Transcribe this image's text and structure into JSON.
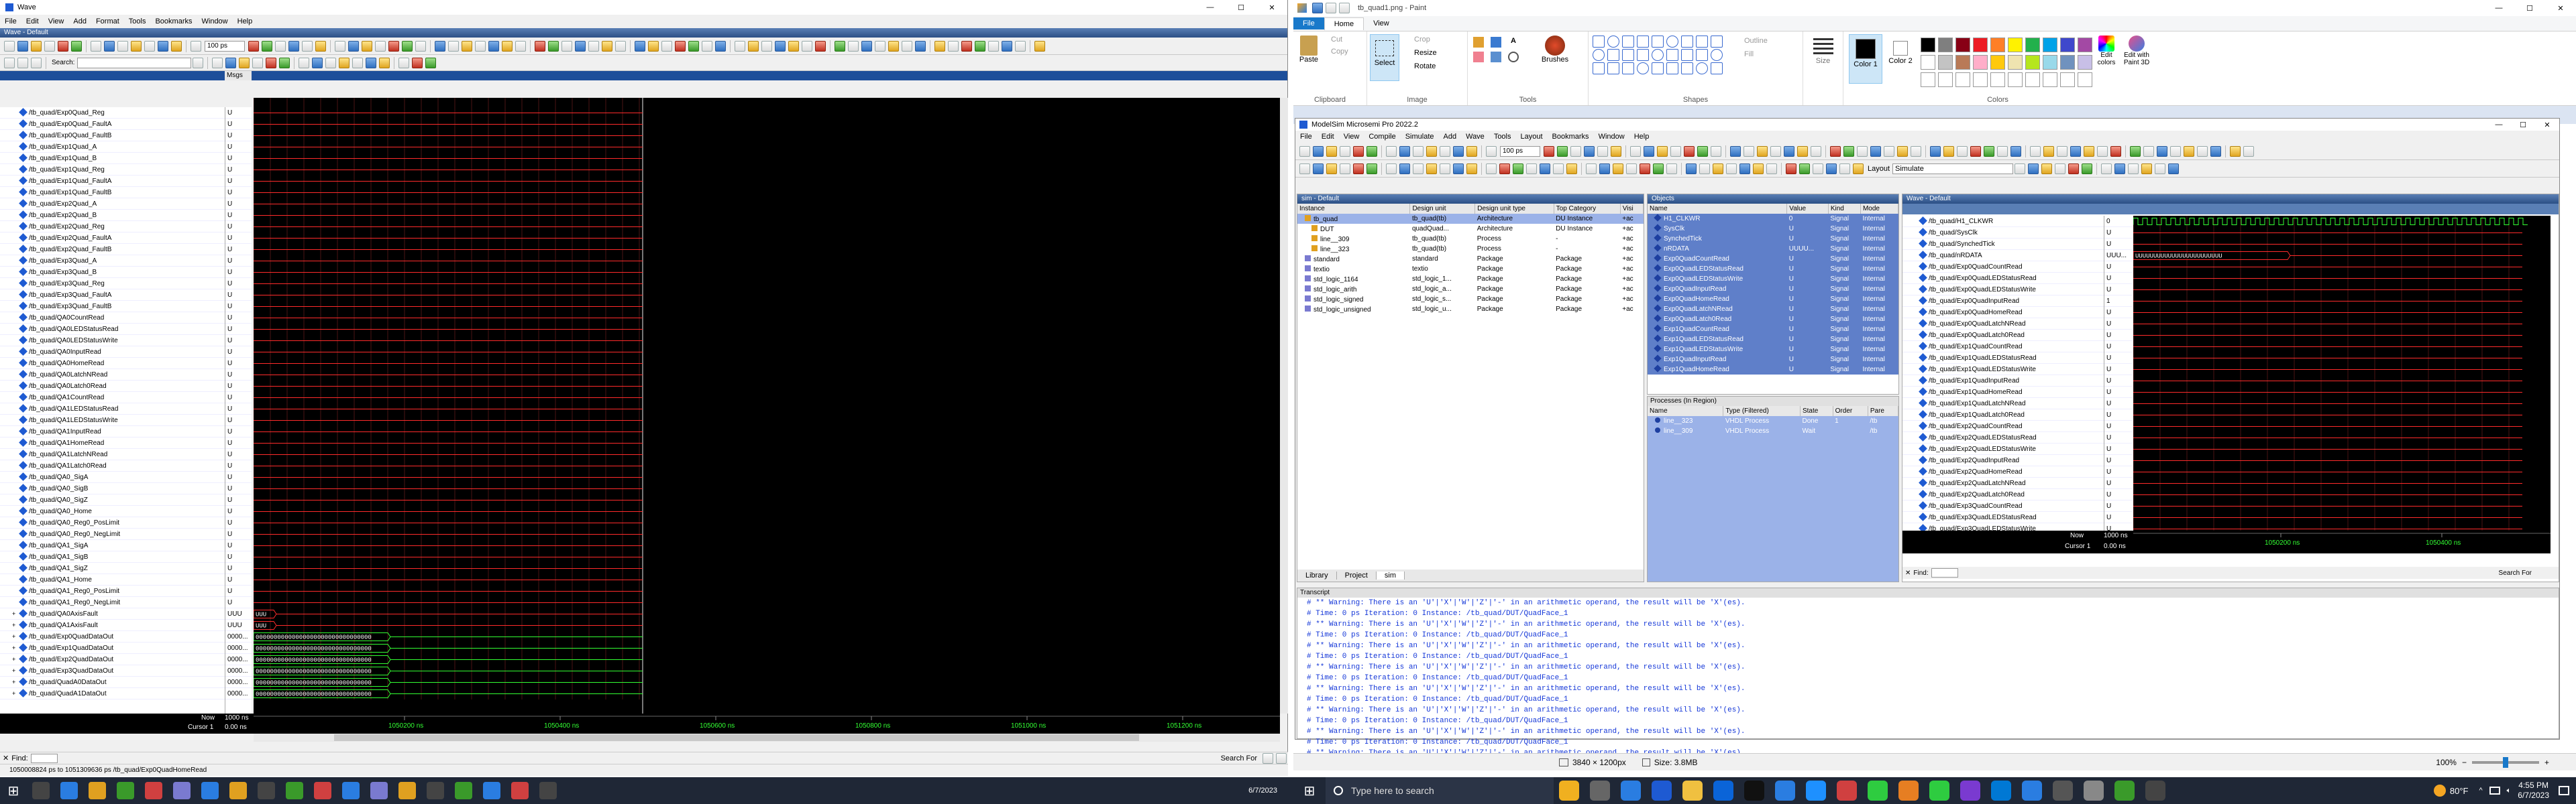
{
  "left_window": {
    "title": "Wave",
    "menu": [
      "File",
      "Edit",
      "View",
      "Add",
      "Format",
      "Tools",
      "Bookmarks",
      "Window",
      "Help"
    ],
    "pane_title": "Wave - Default",
    "time_step": "100 ps",
    "search_placeholder": "Search:",
    "msgs_header": "Msgs",
    "signals": [
      "/tb_quad/Exp0Quad_Reg",
      "/tb_quad/Exp0Quad_FaultA",
      "/tb_quad/Exp0Quad_FaultB",
      "/tb_quad/Exp1Quad_A",
      "/tb_quad/Exp1Quad_B",
      "/tb_quad/Exp1Quad_Reg",
      "/tb_quad/Exp1Quad_FaultA",
      "/tb_quad/Exp1Quad_FaultB",
      "/tb_quad/Exp2Quad_A",
      "/tb_quad/Exp2Quad_B",
      "/tb_quad/Exp2Quad_Reg",
      "/tb_quad/Exp2Quad_FaultA",
      "/tb_quad/Exp2Quad_FaultB",
      "/tb_quad/Exp3Quad_A",
      "/tb_quad/Exp3Quad_B",
      "/tb_quad/Exp3Quad_Reg",
      "/tb_quad/Exp3Quad_FaultA",
      "/tb_quad/Exp3Quad_FaultB",
      "/tb_quad/QA0CountRead",
      "/tb_quad/QA0LEDStatusRead",
      "/tb_quad/QA0LEDStatusWrite",
      "/tb_quad/QA0InputRead",
      "/tb_quad/QA0HomeRead",
      "/tb_quad/QA0LatchNRead",
      "/tb_quad/QA0Latch0Read",
      "/tb_quad/QA1CountRead",
      "/tb_quad/QA1LEDStatusRead",
      "/tb_quad/QA1LEDStatusWrite",
      "/tb_quad/QA1InputRead",
      "/tb_quad/QA1HomeRead",
      "/tb_quad/QA1LatchNRead",
      "/tb_quad/QA1Latch0Read",
      "/tb_quad/QA0_SigA",
      "/tb_quad/QA0_SigB",
      "/tb_quad/QA0_SigZ",
      "/tb_quad/QA0_Home",
      "/tb_quad/QA0_Reg0_PosLimit",
      "/tb_quad/QA0_Reg0_NegLimit",
      "/tb_quad/QA1_SigA",
      "/tb_quad/QA1_SigB",
      "/tb_quad/QA1_SigZ",
      "/tb_quad/QA1_Home",
      "/tb_quad/QA1_Reg0_PosLimit",
      "/tb_quad/QA1_Reg0_NegLimit",
      "/tb_quad/QA0AxisFault",
      "/tb_quad/QA1AxisFault",
      "/tb_quad/Exp0QuadDataOut",
      "/tb_quad/Exp1QuadDataOut",
      "/tb_quad/Exp2QuadDataOut",
      "/tb_quad/Exp3QuadDataOut",
      "/tb_quad/QuadA0DataOut",
      "/tb_quad/QuadA1DataOut"
    ],
    "values": [
      "U",
      "U",
      "U",
      "U",
      "U",
      "U",
      "U",
      "U",
      "U",
      "U",
      "U",
      "U",
      "U",
      "U",
      "U",
      "U",
      "U",
      "U",
      "U",
      "U",
      "U",
      "U",
      "U",
      "U",
      "U",
      "U",
      "U",
      "U",
      "U",
      "U",
      "U",
      "U",
      "U",
      "U",
      "U",
      "U",
      "U",
      "U",
      "U",
      "U",
      "U",
      "U",
      "U",
      "U",
      "UUU",
      "UUU",
      "0000...",
      "0000...",
      "0000...",
      "0000...",
      "0000...",
      "0000..."
    ],
    "bus_text_small": "UUU",
    "bus_text_long": "00000000000000000000000000000000",
    "now_label": "Now",
    "now_value": "1000 ns",
    "cursor_label": "Cursor 1",
    "cursor_value": "0.00 ns",
    "time_ticks": [
      "1050200 ns",
      "1050400 ns",
      "1050600 ns",
      "1050800 ns",
      "1051000 ns",
      "1051200 ns"
    ],
    "find_label": "Find:",
    "search_label": "Search For",
    "status_text": "1050008824 ps to 1051309636 ps  /tb_quad/Exp0QuadHomeRead",
    "date": "6/7/2023"
  },
  "paint": {
    "title": "tb_quad1.png - Paint",
    "tabs": [
      "File",
      "Home",
      "View"
    ],
    "groups": [
      "Clipboard",
      "Image",
      "Tools",
      "Shapes",
      "Colors"
    ],
    "clipboard": [
      "Paste",
      "Cut",
      "Copy"
    ],
    "image": [
      "Select",
      "Crop",
      "Resize",
      "Rotate"
    ],
    "brushes": "Brushes",
    "shapes_opts": [
      "Outline",
      "Fill"
    ],
    "size": "Size",
    "color1": "Color 1",
    "color2": "Color 2",
    "edit_colors": "Edit colors",
    "edit_3d": "Edit with Paint 3D",
    "palette": [
      "#000000",
      "#7f7f7f",
      "#880015",
      "#ed1c24",
      "#ff7f27",
      "#fff200",
      "#22b14c",
      "#00a2e8",
      "#3f48cc",
      "#a349a4",
      "#ffffff",
      "#c3c3c3",
      "#b97a57",
      "#ffaec9",
      "#ffc90e",
      "#efe4b0",
      "#b5e61d",
      "#99d9ea",
      "#7092be",
      "#c8bfe7"
    ],
    "dims": "3840 × 1200px",
    "size_text": "Size: 3.8MB",
    "zoom": "100%"
  },
  "modelsim": {
    "title": "ModelSim Microsemi Pro 2022.2",
    "menu": [
      "File",
      "Edit",
      "View",
      "Compile",
      "Simulate",
      "Add",
      "Wave",
      "Tools",
      "Layout",
      "Bookmarks",
      "Window",
      "Help"
    ],
    "layout_label": "Layout",
    "layout_value": "Simulate",
    "time_step": "100 ps",
    "sim_title": "sim - Default",
    "sim_cols": [
      "Instance",
      "Design unit",
      "Design unit type",
      "Top Category",
      "Visi"
    ],
    "sim_rows": [
      [
        "tb_quad",
        "tb_quad(tb)",
        "Architecture",
        "DU Instance",
        "+ac"
      ],
      [
        "DUT",
        "quadQuad...",
        "Architecture",
        "DU Instance",
        "+ac"
      ],
      [
        "line__309",
        "tb_quad(tb)",
        "Process",
        "-",
        "+ac"
      ],
      [
        "line__323",
        "tb_quad(tb)",
        "Process",
        "-",
        "+ac"
      ],
      [
        "standard",
        "standard",
        "Package",
        "Package",
        "+ac"
      ],
      [
        "textio",
        "textio",
        "Package",
        "Package",
        "+ac"
      ],
      [
        "std_logic_1164",
        "std_logic_1...",
        "Package",
        "Package",
        "+ac"
      ],
      [
        "std_logic_arith",
        "std_logic_a...",
        "Package",
        "Package",
        "+ac"
      ],
      [
        "std_logic_signed",
        "std_logic_s...",
        "Package",
        "Package",
        "+ac"
      ],
      [
        "std_logic_unsigned",
        "std_logic_u...",
        "Package",
        "Package",
        "+ac"
      ]
    ],
    "sim_tabs": [
      "Library",
      "Project",
      "sim"
    ],
    "obj_title": "Objects",
    "obj_cols": [
      "Name",
      "Value",
      "Kind",
      "Mode"
    ],
    "obj_rows": [
      [
        "H1_CLKWR",
        "0",
        "Signal",
        "Internal"
      ],
      [
        "SysClk",
        "U",
        "Signal",
        "Internal"
      ],
      [
        "SynchedTick",
        "U",
        "Signal",
        "Internal"
      ],
      [
        "nRDATA",
        "UUUU...",
        "Signal",
        "Internal"
      ],
      [
        "Exp0QuadCountRead",
        "U",
        "Signal",
        "Internal"
      ],
      [
        "Exp0QuadLEDStatusRead",
        "U",
        "Signal",
        "Internal"
      ],
      [
        "Exp0QuadLEDStatusWrite",
        "U",
        "Signal",
        "Internal"
      ],
      [
        "Exp0QuadInputRead",
        "U",
        "Signal",
        "Internal"
      ],
      [
        "Exp0QuadHomeRead",
        "U",
        "Signal",
        "Internal"
      ],
      [
        "Exp0QuadLatchNRead",
        "U",
        "Signal",
        "Internal"
      ],
      [
        "Exp0QuadLatch0Read",
        "U",
        "Signal",
        "Internal"
      ],
      [
        "Exp1QuadCountRead",
        "U",
        "Signal",
        "Internal"
      ],
      [
        "Exp1QuadLEDStatusRead",
        "U",
        "Signal",
        "Internal"
      ],
      [
        "Exp1QuadLEDStatusWrite",
        "U",
        "Signal",
        "Internal"
      ],
      [
        "Exp1QuadInputRead",
        "U",
        "Signal",
        "Internal"
      ],
      [
        "Exp1QuadHomeRead",
        "U",
        "Signal",
        "Internal"
      ]
    ],
    "proc_title": "Processes (In Region)",
    "proc_cols": [
      "Name",
      "Type (Filtered)",
      "State",
      "Order",
      "Pare"
    ],
    "proc_rows": [
      [
        "line__323",
        "VHDL Process",
        "Done",
        "1",
        "/tb"
      ],
      [
        "line__309",
        "VHDL Process",
        "Wait",
        "",
        "/tb"
      ]
    ],
    "wave_title": "Wave - Default",
    "wave_signals": [
      "/tb_quad/H1_CLKWR",
      "/tb_quad/SysClk",
      "/tb_quad/SynchedTick",
      "/tb_quad/nRDATA",
      "/tb_quad/Exp0QuadCountRead",
      "/tb_quad/Exp0QuadLEDStatusRead",
      "/tb_quad/Exp0QuadLEDStatusWrite",
      "/tb_quad/Exp0QuadInputRead",
      "/tb_quad/Exp0QuadHomeRead",
      "/tb_quad/Exp0QuadLatchNRead",
      "/tb_quad/Exp0QuadLatch0Read",
      "/tb_quad/Exp1QuadCountRead",
      "/tb_quad/Exp1QuadLEDStatusRead",
      "/tb_quad/Exp1QuadLEDStatusWrite",
      "/tb_quad/Exp1QuadInputRead",
      "/tb_quad/Exp1QuadHomeRead",
      "/tb_quad/Exp1QuadLatchNRead",
      "/tb_quad/Exp1QuadLatch0Read",
      "/tb_quad/Exp2QuadCountRead",
      "/tb_quad/Exp2QuadLEDStatusRead",
      "/tb_quad/Exp2QuadLEDStatusWrite",
      "/tb_quad/Exp2QuadInputRead",
      "/tb_quad/Exp2QuadHomeRead",
      "/tb_quad/Exp2QuadLatchNRead",
      "/tb_quad/Exp2QuadLatch0Read",
      "/tb_quad/Exp3QuadCountRead",
      "/tb_quad/Exp3QuadLEDStatusRead",
      "/tb_quad/Exp3QuadLEDStatusWrite"
    ],
    "wave_values": [
      "0",
      "U",
      "U",
      "UUU...",
      "U",
      "U",
      "U",
      "1",
      "U",
      "U",
      "U",
      "U",
      "U",
      "U",
      "U",
      "U",
      "U",
      "U",
      "U",
      "U",
      "U",
      "U",
      "U",
      "U",
      "U",
      "U",
      "U",
      "U"
    ],
    "wave_bus_text": "UUUUUUUUUUUUUUUUUUUUUUUU",
    "now_label": "Now",
    "now_value": "1000 ns",
    "cursor_label": "Cursor 1",
    "cursor_value": "0.00 ns",
    "ticks": [
      "1050200 ns",
      "1050400 ns"
    ],
    "find_label": "Find:",
    "search_label": "Search For",
    "transcript_title": "Transcript",
    "transcript": [
      "# ** Warning: There is an 'U'|'X'|'W'|'Z'|'-' in an arithmetic operand, the result will be 'X'(es).",
      "#    Time: 0 ps  Iteration: 0  Instance: /tb_quad/DUT/QuadFace_1",
      "# ** Warning: There is an 'U'|'X'|'W'|'Z'|'-' in an arithmetic operand, the result will be 'X'(es).",
      "#    Time: 0 ps  Iteration: 0  Instance: /tb_quad/DUT/QuadFace_1",
      "# ** Warning: There is an 'U'|'X'|'W'|'Z'|'-' in an arithmetic operand, the result will be 'X'(es).",
      "#    Time: 0 ps  Iteration: 0  Instance: /tb_quad/DUT/QuadFace_1",
      "# ** Warning: There is an 'U'|'X'|'W'|'Z'|'-' in an arithmetic operand, the result will be 'X'(es).",
      "#    Time: 0 ps  Iteration: 0  Instance: /tb_quad/DUT/QuadFace_1",
      "# ** Warning: There is an 'U'|'X'|'W'|'Z'|'-' in an arithmetic operand, the result will be 'X'(es).",
      "#    Time: 0 ps  Iteration: 0  Instance: /tb_quad/DUT/QuadFace_1",
      "# ** Warning: There is an 'U'|'X'|'W'|'Z'|'-' in an arithmetic operand, the result will be 'X'(es).",
      "#    Time: 0 ps  Iteration: 0  Instance: /tb_quad/DUT/QuadFace_1",
      "# ** Warning: There is an 'U'|'X'|'W'|'Z'|'-' in an arithmetic operand, the result will be 'X'(es).",
      "#    Time: 0 ps  Iteration: 0  Instance: /tb_quad/DUT/QuadFace_1",
      "# ** Warning: There is an 'U'|'X'|'W'|'Z'|'-' in an arithmetic operand, the result will be 'X'(es)."
    ]
  },
  "taskbar": {
    "search_placeholder": "Type here to search",
    "temp": "80°F",
    "time": "4:55 PM",
    "date": "6/7/2023"
  }
}
